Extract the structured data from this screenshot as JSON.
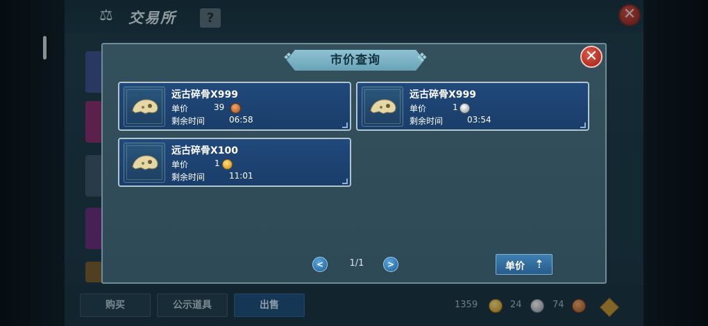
{
  "exchange": {
    "title": "交易所",
    "help_label": "?",
    "close_label": "✕",
    "tabs": [
      {
        "label": "购买"
      },
      {
        "label": "公示道具"
      },
      {
        "label": "出售"
      }
    ],
    "currencies": [
      {
        "amount": "1359",
        "icon": "gold-coin-icon"
      },
      {
        "amount": "24",
        "icon": "silver-coin-icon"
      },
      {
        "amount": "74",
        "icon": "copper-coin-icon"
      }
    ]
  },
  "popup": {
    "title": "市价查询",
    "close_label": "✕",
    "price_label": "单价",
    "time_label": "剩余时间",
    "listings": [
      {
        "name": "远古碎骨X999",
        "price": "39",
        "coin": "copper",
        "time": "06:58"
      },
      {
        "name": "远古碎骨X999",
        "price": "1",
        "coin": "silver",
        "time": "03:54"
      },
      {
        "name": "远古碎骨X100",
        "price": "1",
        "coin": "gold",
        "time": "11:01"
      }
    ],
    "pagination": {
      "prev": "<",
      "next": ">",
      "page": "1/1"
    },
    "sort_button": "单价"
  },
  "colors": {
    "card_bg": "#1f4677",
    "popup_bg": "#31505c",
    "close_red": "#c0392b",
    "accent_blue": "#3f7fb2"
  }
}
